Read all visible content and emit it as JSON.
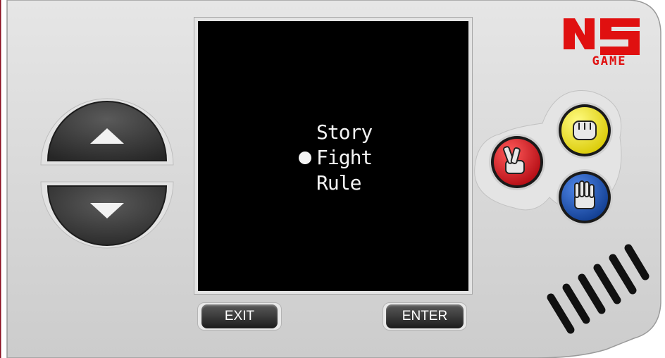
{
  "menu": {
    "items": [
      {
        "label": "Story",
        "selected": false
      },
      {
        "label": "Fight",
        "selected": true
      },
      {
        "label": "Rule",
        "selected": false
      }
    ]
  },
  "buttons": {
    "exit_label": "EXIT",
    "enter_label": "ENTER"
  },
  "logo": {
    "top_text": "NS",
    "bottom_text": "GAME",
    "color": "#e01010"
  },
  "action_buttons": [
    {
      "name": "scissors",
      "color": "#e0141c"
    },
    {
      "name": "rock",
      "color": "#f5e800"
    },
    {
      "name": "paper",
      "color": "#1a52b8"
    }
  ],
  "colors": {
    "body": "#d8d8d8",
    "screen": "#000000",
    "dpad": "#3a3a3a"
  }
}
